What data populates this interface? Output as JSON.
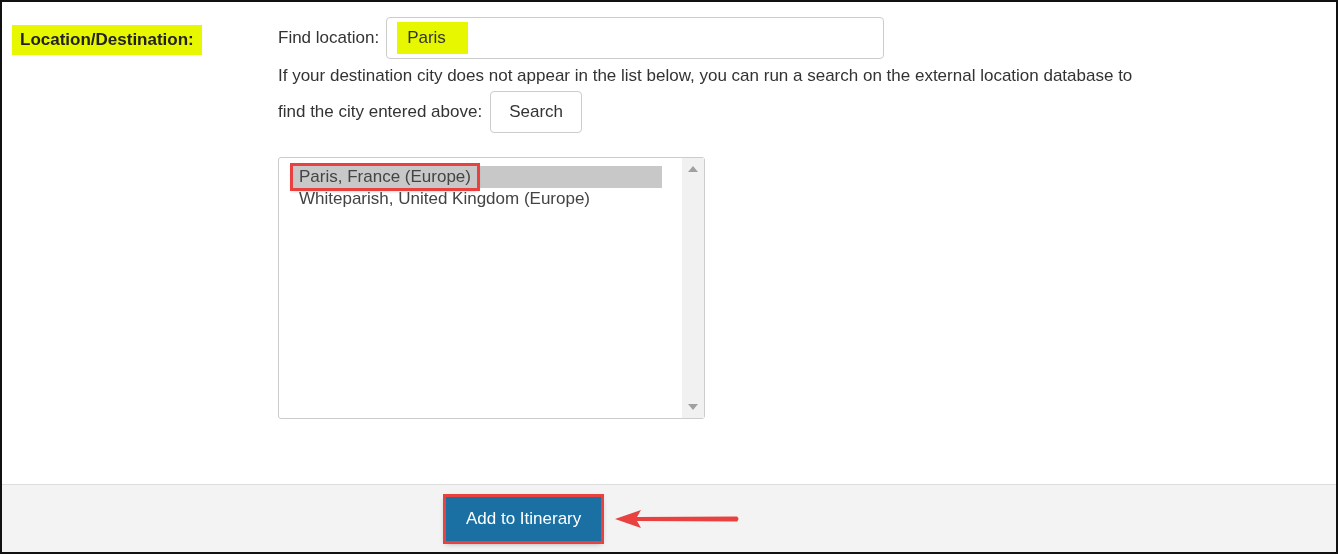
{
  "field_label": {
    "text": "Location/Destination:",
    "highlighted": true
  },
  "find_location": {
    "label": "Find location:",
    "value": "Paris",
    "highlighted": true
  },
  "help_text": [
    "If your destination city does not appear in the list below, you can run a search on the external location database to",
    "find the city entered above:"
  ],
  "search_button": "Search",
  "locations": [
    {
      "label": "Paris, France (Europe)",
      "selected": true,
      "outlined": true
    },
    {
      "label": "Whiteparish, United Kingdom (Europe)",
      "selected": false,
      "outlined": false
    }
  ],
  "footer": {
    "button": "Add to Itinerary",
    "outlined": true
  }
}
